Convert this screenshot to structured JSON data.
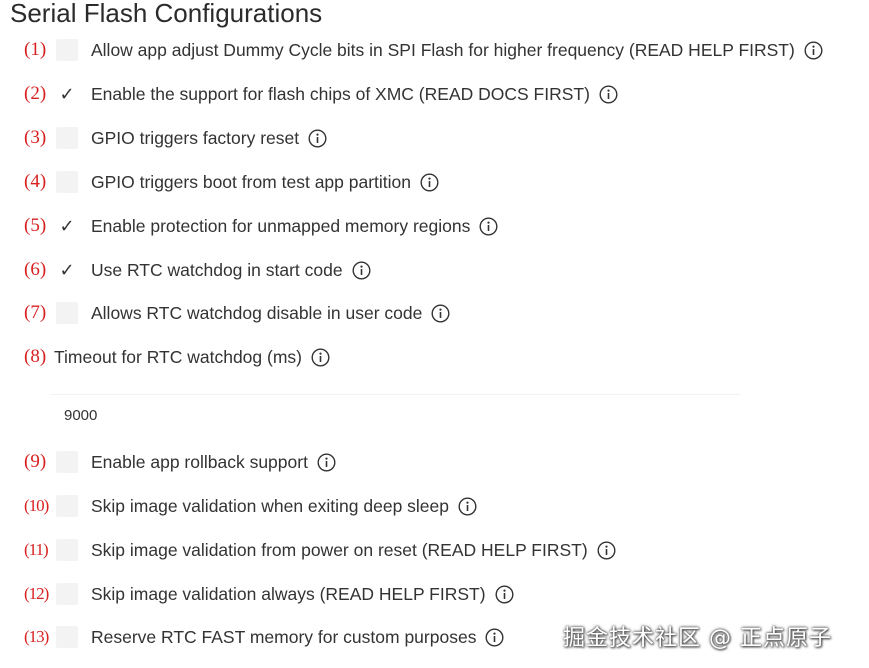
{
  "page": {
    "title": "Serial Flash Configurations"
  },
  "colors": {
    "annotation_red": "#d92020",
    "text": "#333333",
    "checkbox_bg": "#f3f3f3"
  },
  "options": [
    {
      "num": "(1)",
      "checked": false,
      "checkmark": "",
      "label": "Allow app adjust Dummy Cycle bits in SPI Flash for higher frequency (READ HELP FIRST)",
      "icon": "info-icon"
    },
    {
      "num": "(2)",
      "checked": true,
      "checkmark": "✓",
      "label": "Enable the support for flash chips of XMC (READ DOCS FIRST)",
      "icon": "info-icon"
    },
    {
      "num": "(3)",
      "checked": false,
      "checkmark": "",
      "label": "GPIO triggers factory reset",
      "icon": "info-icon"
    },
    {
      "num": "(4)",
      "checked": false,
      "checkmark": "",
      "label": "GPIO triggers boot from test app partition",
      "icon": "info-icon"
    },
    {
      "num": "(5)",
      "checked": true,
      "checkmark": "✓",
      "label": "Enable protection for unmapped memory regions",
      "icon": "info-icon"
    },
    {
      "num": "(6)",
      "checked": true,
      "checkmark": "✓",
      "label": "Use RTC watchdog in start code",
      "icon": "info-icon"
    },
    {
      "num": "(7)",
      "checked": false,
      "checkmark": "",
      "label": "Allows RTC watchdog disable in user code",
      "icon": "info-icon"
    },
    {
      "num": "(9)",
      "checked": false,
      "checkmark": "",
      "label": "Enable app rollback support",
      "icon": "info-icon"
    },
    {
      "num": "(10)",
      "checked": false,
      "checkmark": "",
      "label": "Skip image validation when exiting deep sleep",
      "icon": "info-icon"
    },
    {
      "num": "(11)",
      "checked": false,
      "checkmark": "",
      "label": "Skip image validation from power on reset (READ HELP FIRST)",
      "icon": "info-icon"
    },
    {
      "num": "(12)",
      "checked": false,
      "checkmark": "",
      "label": "Skip image validation always (READ HELP FIRST)",
      "icon": "info-icon"
    },
    {
      "num": "(13)",
      "checked": false,
      "checkmark": "",
      "label": "Reserve RTC FAST memory for custom purposes",
      "icon": "info-icon"
    }
  ],
  "timeout": {
    "num": "(8)",
    "label": "Timeout for RTC watchdog (ms)",
    "value": "9000",
    "icon": "info-icon"
  },
  "watermark": "掘金技术社区 @ 正点原子"
}
